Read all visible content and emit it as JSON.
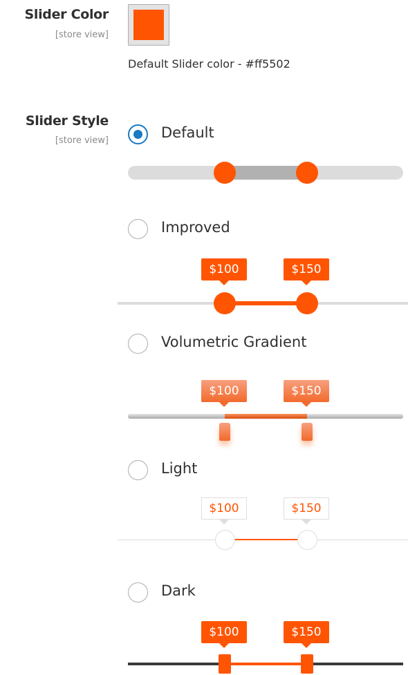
{
  "slider_color": {
    "title": "Slider Color",
    "scope": "[store view]",
    "value": "#ff5502",
    "note": "Default Slider color - #ff5502"
  },
  "slider_style": {
    "title": "Slider Style",
    "scope": "[store view]",
    "selected": "Default",
    "options": [
      {
        "label": "Default",
        "checked": true
      },
      {
        "label": "Improved",
        "checked": false,
        "tips": [
          "$100",
          "$150"
        ]
      },
      {
        "label": "Volumetric Gradient",
        "checked": false,
        "tips": [
          "$100",
          "$150"
        ]
      },
      {
        "label": "Light",
        "checked": false,
        "tips": [
          "$100",
          "$150"
        ]
      },
      {
        "label": "Dark",
        "checked": false,
        "tips": [
          "$100",
          "$150"
        ]
      }
    ]
  },
  "colors": {
    "accent": "#ff5502",
    "radio_selected": "#1979c3",
    "dark_track": "#3a3a3a",
    "gradient_start": "#f7a07e",
    "gradient_end": "#f26a2c"
  }
}
